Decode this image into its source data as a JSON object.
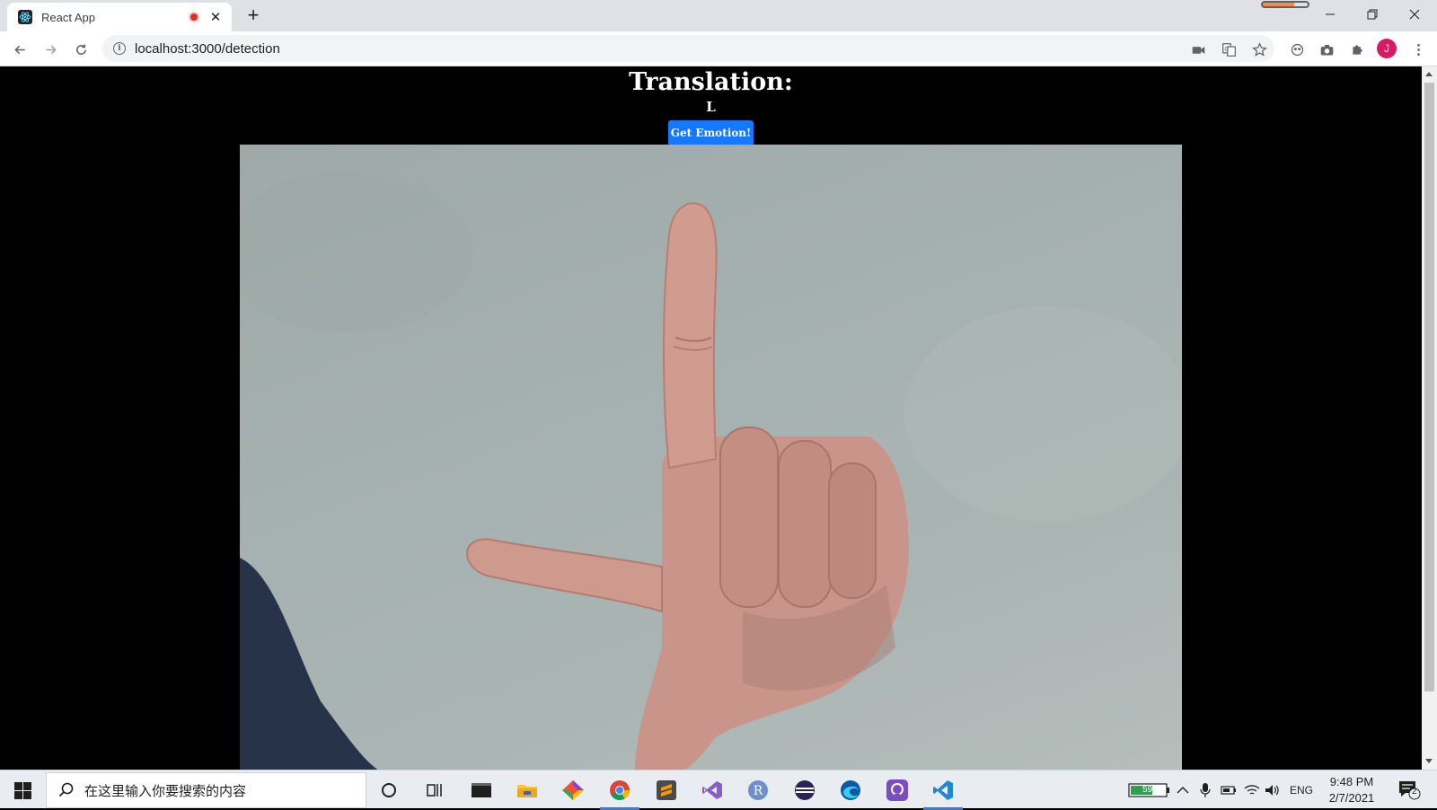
{
  "browser": {
    "tab_title": "React App",
    "new_tab_symbol": "+",
    "url": "localhost:3000/detection",
    "profile_initial": "J"
  },
  "page": {
    "heading": "Translation:",
    "result_letter": "L",
    "button_label": "Get Emotion!",
    "colors": {
      "background": "#000000",
      "button": "#1677ff",
      "text": "#ffffff"
    }
  },
  "taskbar": {
    "search_placeholder": "在这里输入你要搜索的内容",
    "battery_percent": "59%",
    "language": "ENG",
    "time": "9:48 PM",
    "date": "2/7/2021",
    "notification_count": "2",
    "apps": [
      "cortana-icon",
      "task-view-icon",
      "terminal-icon",
      "file-explorer-icon",
      "git-icon",
      "chrome-icon",
      "sublime-text-icon",
      "visual-studio-icon",
      "r-icon",
      "eclipse-icon",
      "edge-icon",
      "github-icon",
      "vscode-icon"
    ]
  }
}
